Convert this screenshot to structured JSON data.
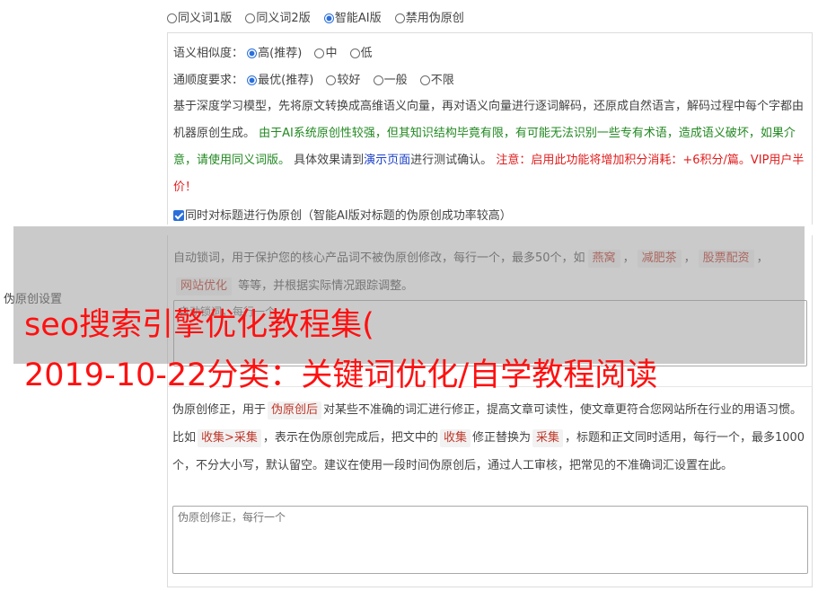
{
  "modes": {
    "options": [
      "同义词1版",
      "同义词2版",
      "智能AI版",
      "禁用伪原创"
    ],
    "selected": 2
  },
  "similarity": {
    "label": "语义相似度：",
    "options": [
      "高(推荐)",
      "中",
      "低"
    ],
    "selected": 0
  },
  "fluency": {
    "label": "通顺度要求：",
    "options": [
      "最优(推荐)",
      "较好",
      "一般",
      "不限"
    ],
    "selected": 0
  },
  "desc": {
    "p1": "基于深度学习模型，先将原文转换成高维语义向量，再对语义向量进行逐词解码，还原成自然语言，解码过程中每个字都由机器原创生成。 ",
    "p2_green_a": "由于AI系统原创性较强，但其知识结构毕竟有限，有可能无法识别一些专有术语，造成语义破坏，如果介意，请使用同义词版。",
    "p3_a": " 具体效果请到",
    "p3_link": "演示页面",
    "p3_b": "进行测试确认。 ",
    "p4_red": "注意：启用此功能将增加积分消耗：+6积分/篇。VIP用户半价！"
  },
  "title_checkbox": {
    "label": "同时对标题进行伪原创（智能AI版对标题的伪原创成功率较高）",
    "checked": true
  },
  "lock": {
    "desc_a": "自动锁词，用于保护您的核心产品词不被伪原创修改，每行一个，最多50个，如",
    "tags": [
      "燕窝",
      "减肥茶",
      "股票配资",
      "网站优化"
    ],
    "desc_b": " 等等，并根据实际情况跟踪调整。",
    "placeholder": "自动锁词，每行一个"
  },
  "settings_label": "伪原创设置",
  "headline": {
    "line1": "seo搜索引擎优化教程集(",
    "line2": "2019-10-22分类：关键词优化/自学教程阅读"
  },
  "correction": {
    "p_a": "伪原创修正，用于",
    "tag1": "伪原创后",
    "p_b": "对某些不准确的词汇进行修正，提高文章可读性，使文章更符合您网站所在行业的用语习惯。比如",
    "tag2": "收集>采集",
    "p_c": "，表示在伪原创完成后，把文中的",
    "tag3": "收集",
    "p_d": "修正替换为",
    "tag4": "采集",
    "p_e": "，标题和正文同时适用，每行一个，最多1000个，不分大小写，默认留空。建议在使用一段时间伪原创后，通过人工审核，把常见的不准确词汇设置在此。",
    "placeholder": "伪原创修正，每行一个"
  },
  "colors": {
    "accent": "#2a6fdb",
    "green_text": "#228822",
    "link": "#1a3ec8",
    "warning": "#e11d1d",
    "overlay_text": "#ff1010"
  }
}
